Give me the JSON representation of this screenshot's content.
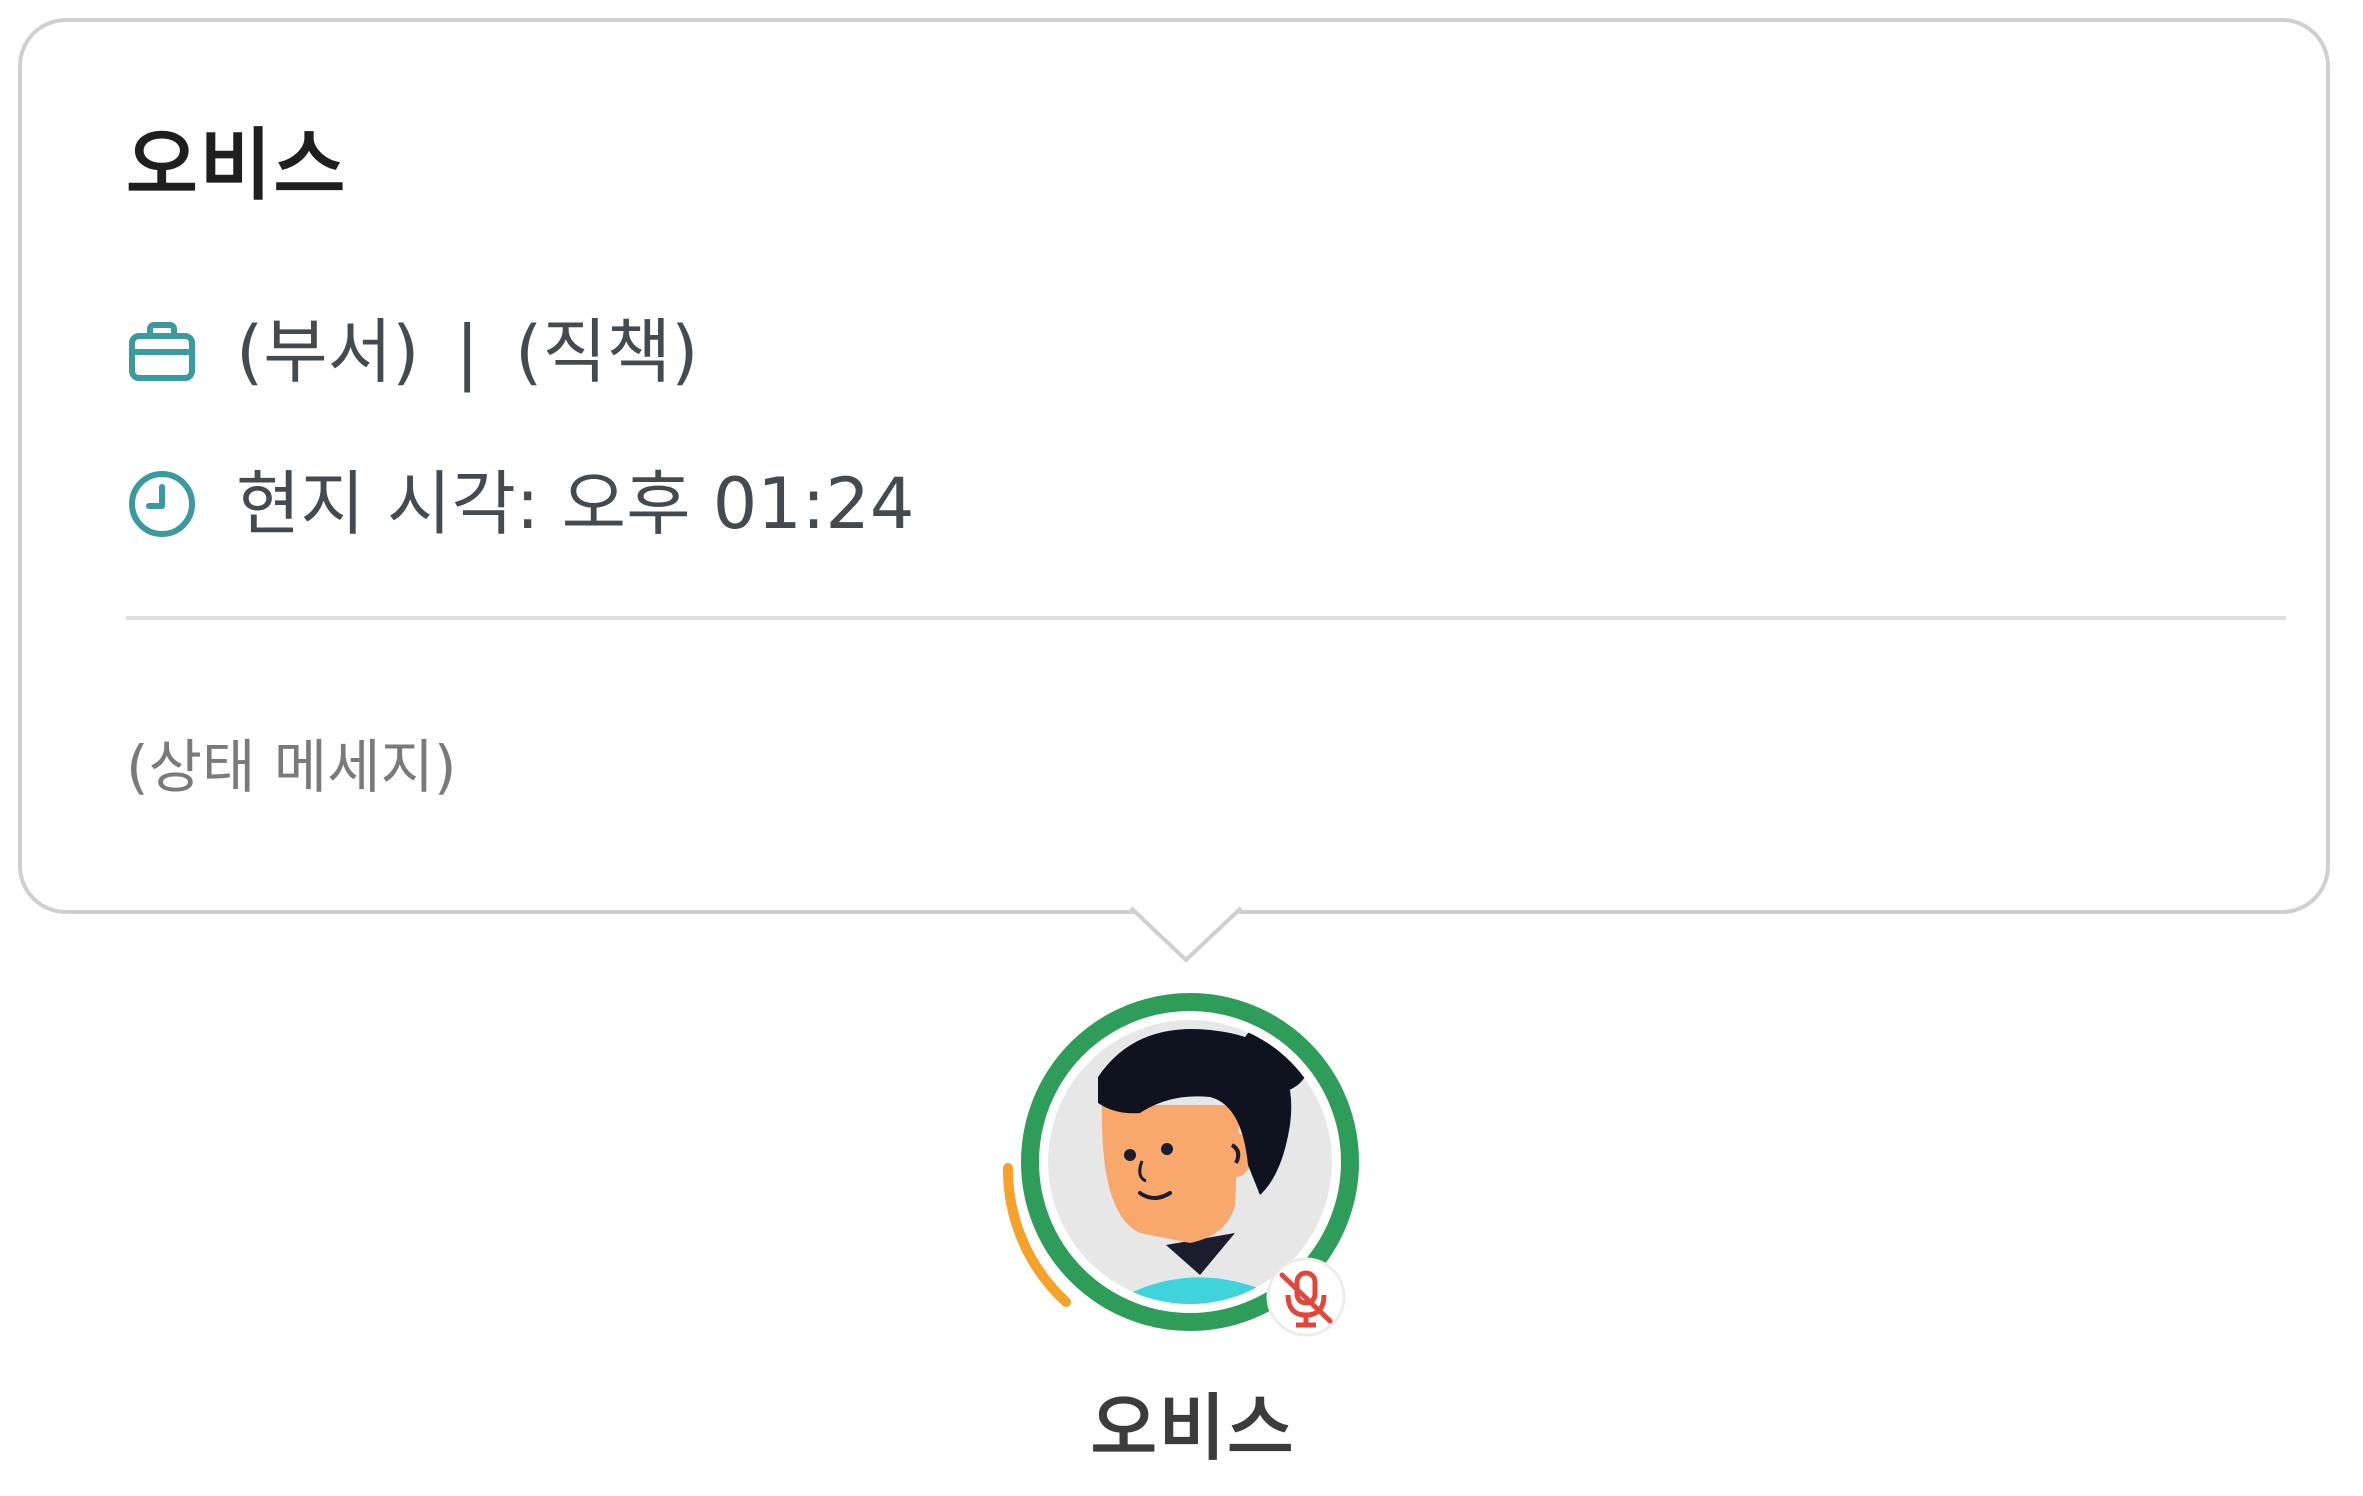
{
  "popover": {
    "name": "오비스",
    "department": "(부서)",
    "separator": "|",
    "position": "(직책)",
    "local_time": "현지 시각: 오후 01:24",
    "status_message": "(상태 메세지)"
  },
  "user_tile": {
    "name": "오비스",
    "presence_color": "#2e9d5a",
    "speaking_indicator_color": "#f5a12a",
    "mic_state": "muted",
    "mic_icon": "mic-off-icon"
  },
  "icons": {
    "department": "briefcase-icon",
    "time": "clock-icon"
  },
  "colors": {
    "icon_teal": "#3a9a9e",
    "muted_red": "#e0463a"
  }
}
